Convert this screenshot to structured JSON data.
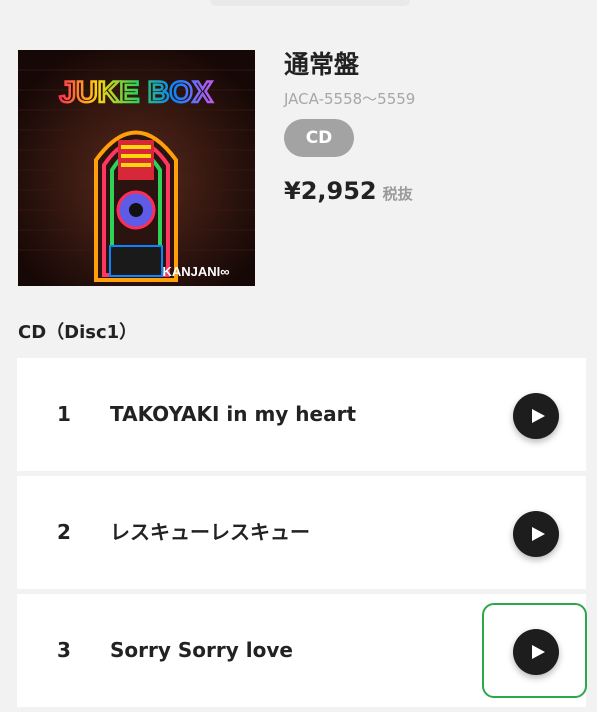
{
  "album": {
    "cover_title": "JUKE BOX",
    "cover_artist": "KANJANI∞",
    "edition": "通常盤",
    "catalog_number": "JACA-5558〜5559",
    "format": "CD",
    "price": "¥2,952",
    "tax_label": "税抜"
  },
  "disc": {
    "title": "CD（Disc1）",
    "tracks": [
      {
        "number": "1",
        "title": "TAKOYAKI in my heart",
        "action": "play-icon"
      },
      {
        "number": "2",
        "title": "レスキューレスキュー",
        "action": "play-icon"
      },
      {
        "number": "3",
        "title": "Sorry Sorry love",
        "action": "play-icon"
      }
    ]
  },
  "colors": {
    "background": "#f2f2f2",
    "card": "#ffffff",
    "badge": "#a3a3a3",
    "play_button": "#1d1d1d",
    "highlight": "#2aa84a"
  }
}
